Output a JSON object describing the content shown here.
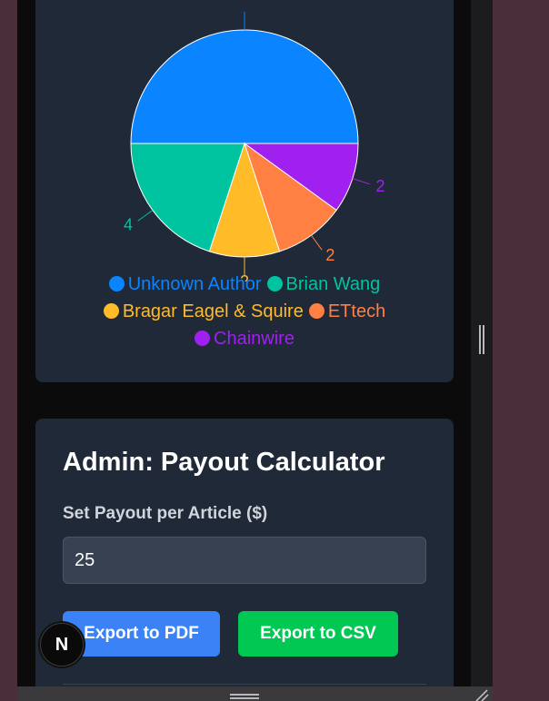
{
  "colors": {
    "unknown_author": "#0a84ff",
    "brian_wang": "#00c49f",
    "bragar": "#ffbb28",
    "ettech": "#ff8042",
    "chainwire": "#a020f0"
  },
  "chart_data": {
    "type": "pie",
    "series": [
      {
        "name": "Unknown Author",
        "value": 10,
        "color": "#0a84ff",
        "label": ""
      },
      {
        "name": "Chainwire",
        "value": 2,
        "color": "#a020f0",
        "label": "2"
      },
      {
        "name": "ETtech",
        "value": 2,
        "color": "#ff8042",
        "label": "2"
      },
      {
        "name": "Bragar Eagel & Squire",
        "value": 2,
        "color": "#ffbb28",
        "label": "2"
      },
      {
        "name": "Brian Wang",
        "value": 4,
        "color": "#00c49f",
        "label": "4"
      }
    ],
    "legend_rows": [
      [
        {
          "name": "Unknown Author",
          "color": "#0a84ff"
        },
        {
          "name": "Brian Wang",
          "color": "#00c49f"
        }
      ],
      [
        {
          "name": "Bragar Eagel & Squire",
          "color": "#ffbb28"
        },
        {
          "name": "ETtech",
          "color": "#ff8042"
        }
      ],
      [
        {
          "name": "Chainwire",
          "color": "#a020f0"
        }
      ]
    ]
  },
  "admin": {
    "title": "Admin: Payout Calculator",
    "payout_label": "Set Payout per Article ($)",
    "payout_value": "25",
    "export_pdf_label": "Export to PDF",
    "export_csv_label": "Export to CSV"
  },
  "dev_badge": {
    "letter": "N"
  }
}
